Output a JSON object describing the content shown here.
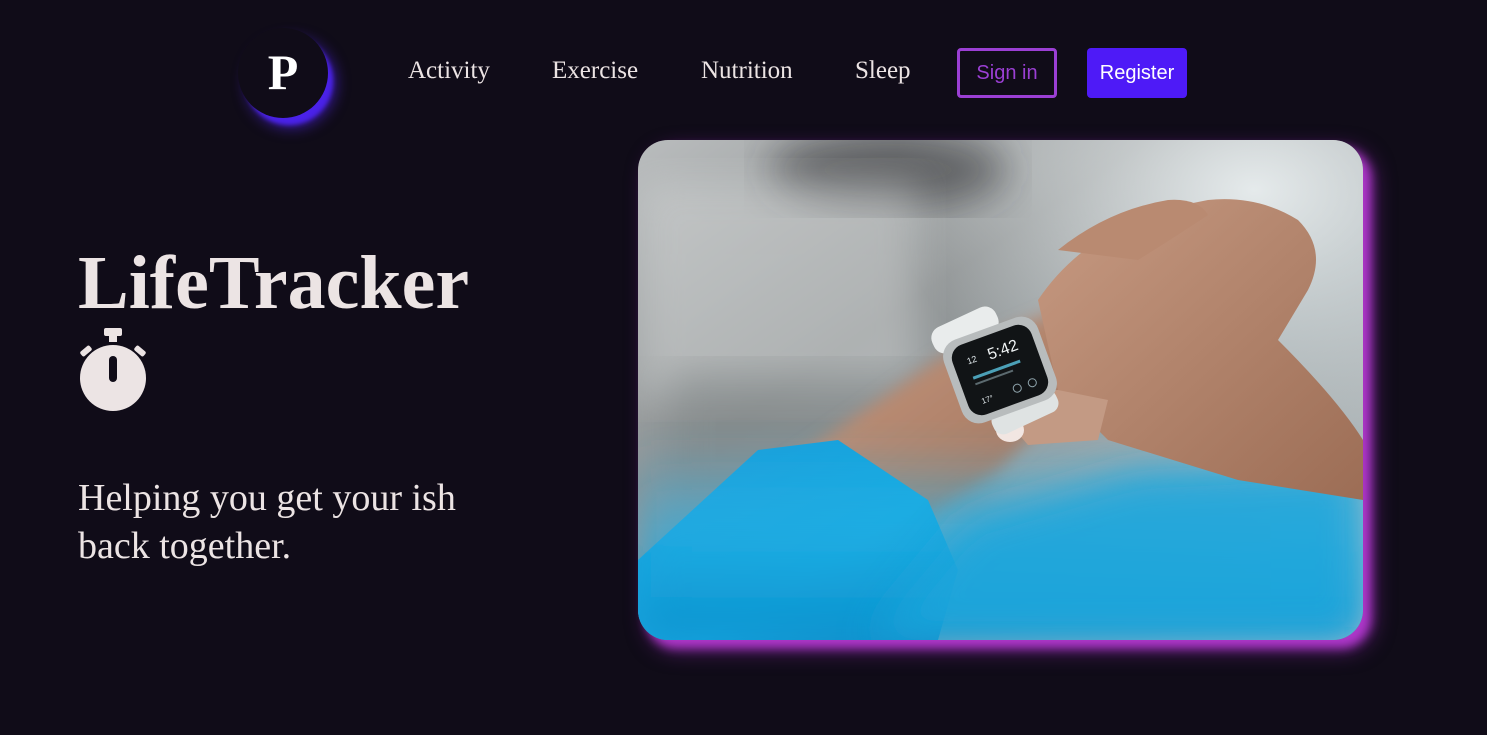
{
  "logo": {
    "letter": "P"
  },
  "nav": {
    "items": [
      {
        "label": "Activity"
      },
      {
        "label": "Exercise"
      },
      {
        "label": "Nutrition"
      },
      {
        "label": "Sleep"
      }
    ],
    "signin_label": "Sign in",
    "register_label": "Register"
  },
  "hero": {
    "title": "LifeTracker",
    "title_icon": "stopwatch-icon",
    "tagline": "Helping you get your ish back together.",
    "image": "smartwatch-photo"
  },
  "watch": {
    "time": "5:42",
    "date": "12",
    "temp": "17°"
  },
  "colors": {
    "background": "#100c18",
    "text": "#ece4e4",
    "signin_accent": "#9b3fd4",
    "register_bg": "#4e1af7",
    "logo_glow": "#4a22e8",
    "image_glow": "#be3cdc"
  }
}
